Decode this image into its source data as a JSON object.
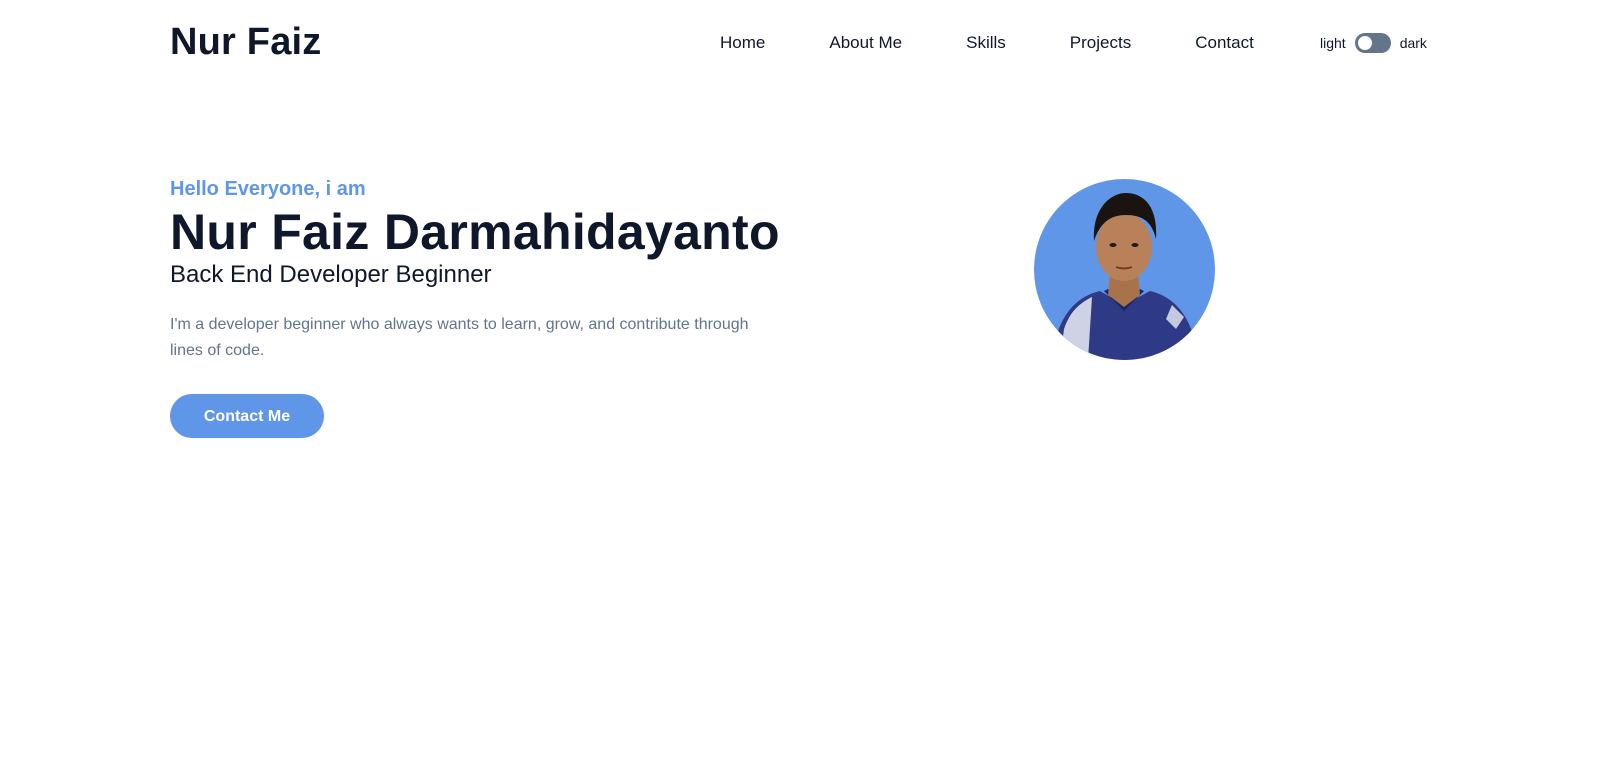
{
  "header": {
    "logo": "Nur Faiz",
    "nav": [
      {
        "label": "Home"
      },
      {
        "label": "About Me"
      },
      {
        "label": "Skills"
      },
      {
        "label": "Projects"
      },
      {
        "label": "Contact"
      }
    ],
    "theme_toggle": {
      "light_label": "light",
      "dark_label": "dark",
      "state": "light"
    }
  },
  "hero": {
    "greeting": "Hello Everyone, i am",
    "name": "Nur Faiz Darmahidayanto",
    "role": "Back End Developer Beginner",
    "description": "I'm a developer beginner who always wants to learn, grow, and contribute through lines of code.",
    "cta_label": "Contact Me"
  },
  "colors": {
    "accent": "#6096e8",
    "text_dark": "#0f172a",
    "text_muted": "#64748b",
    "toggle_track": "#64748b",
    "background": "#ffffff"
  }
}
